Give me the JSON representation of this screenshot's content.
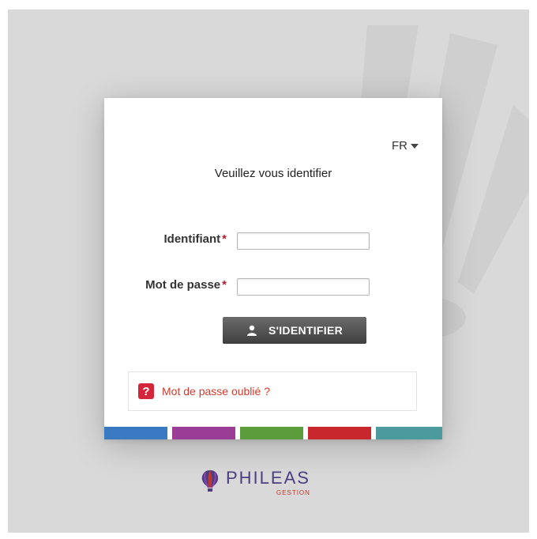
{
  "language": {
    "selected": "FR"
  },
  "form": {
    "title": "Veuillez vous identifier",
    "username_label": "Identifiant",
    "password_label": "Mot de passe",
    "required_mark": "*",
    "username_value": "",
    "password_value": "",
    "submit_label": "S'IDENTIFIER"
  },
  "forgot": {
    "label": "Mot de passe oublié ?",
    "icon": "question-icon"
  },
  "color_bars": [
    "#3a7ac3",
    "#9b3c96",
    "#5d9c3a",
    "#c9272e",
    "#4c9a9e"
  ],
  "brand": {
    "name": "PHILEAS",
    "sub": "GESTION",
    "logo_icon": "hot-air-balloon-icon"
  }
}
